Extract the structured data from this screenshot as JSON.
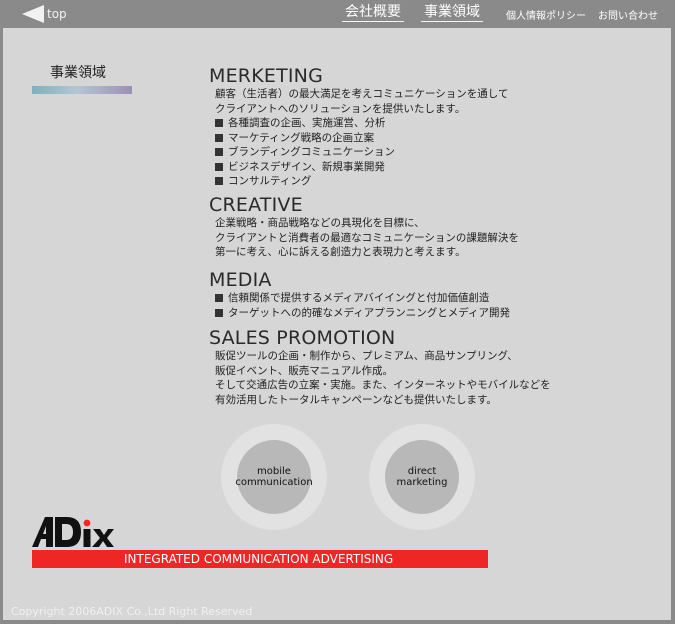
{
  "nav": {
    "back_label": "top",
    "company": "会社概要",
    "business": "事業領域",
    "privacy": "個人情報ポリシー",
    "contact": "お問い合わせ"
  },
  "side": {
    "title": "事業領域"
  },
  "sections": {
    "merketing": {
      "title": "MERKETING",
      "lines": [
        "顧客（生活者）の最大満足を考えコミュニケーションを通して",
        "クライアントへのソリューションを提供いたします。"
      ],
      "items": [
        "各種調査の企画、実施運営、分析",
        "マーケティング戦略の企画立案",
        "ブランディングコミュニケーション",
        "ビジネスデザイン、新規事業開発",
        "コンサルティング"
      ]
    },
    "creative": {
      "title": "CREATIVE",
      "lines": [
        "企業戦略・商品戦略などの具現化を目標に、",
        "クライアントと消費者の最適なコミュニケーションの課題解決を",
        "第一に考え、心に訴える創造力と表現力と考えます。"
      ]
    },
    "media": {
      "title": "MEDIA",
      "items": [
        "信頼関係で提供するメディアバイイングと付加価値創造",
        "ターゲットへの的確なメディアプランニングとメディア開発"
      ]
    },
    "sales": {
      "title": "SALES PROMOTION",
      "lines": [
        "販促ツールの企画・制作から、プレミアム、商品サンプリング、",
        "販促イベント、販売マニュアル作成。",
        "そして交通広告の立案・実施。また、インターネットやモバイルなどを",
        "有効活用したトータルキャンペーンなども提供いたします。"
      ]
    }
  },
  "circles": {
    "mobile": [
      "mobile",
      "communication"
    ],
    "direct": [
      "direct",
      "marketing"
    ]
  },
  "brand": {
    "logo_text": "ADiX",
    "tagline": "INTEGRATED COMMUNICATION ADVERTISING",
    "band_color": "#ee2626"
  },
  "footer": {
    "copyright": "Copyright 2006ADIX Co.,Ltd Right Reserved"
  }
}
